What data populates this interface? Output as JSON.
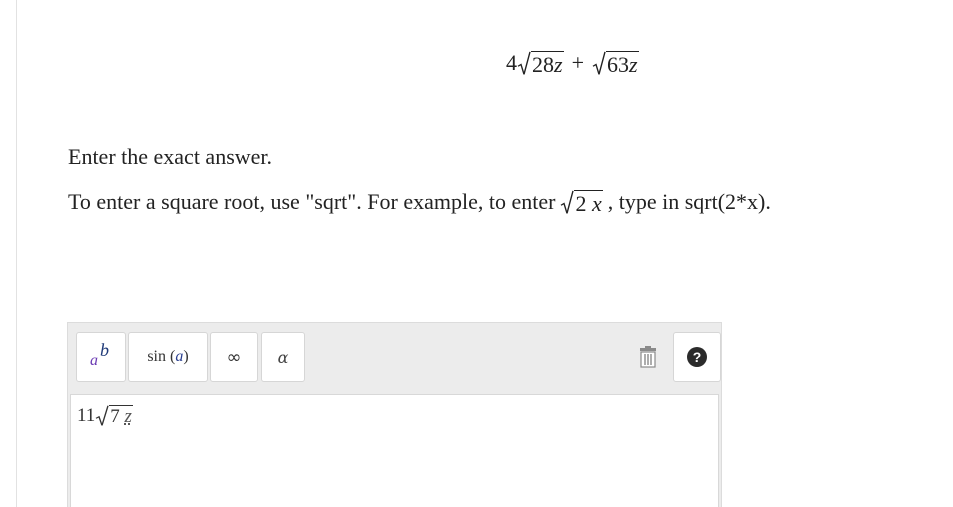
{
  "problem": {
    "coef": "4",
    "radicand1_num": "28",
    "radicand1_var": "z",
    "operator": "+",
    "radicand2_num": "63",
    "radicand2_var": "z"
  },
  "instructions": {
    "line1": "Enter the exact answer.",
    "line2_before": "To enter a square root, use \"sqrt\". For example, to enter",
    "example_num": "2",
    "example_var": "x",
    "line2_after": ", type in sqrt(2*x)."
  },
  "toolbar": {
    "power_base": "a",
    "power_exp": "b",
    "sin_func": "sin",
    "sin_arg": "a",
    "infinity": "∞",
    "alpha": "α",
    "help": "?",
    "icons": {
      "power": "superscript-icon",
      "trash": "trash-icon",
      "help": "help-icon"
    }
  },
  "answer": {
    "coef": "11",
    "radicand_num": "7",
    "radicand_var": "z"
  },
  "colors": {
    "toolbar_bg": "#ececec",
    "power_base": "#6a3ab3",
    "power_exp": "#1f3a78",
    "help_bg": "#2b2b2b"
  }
}
